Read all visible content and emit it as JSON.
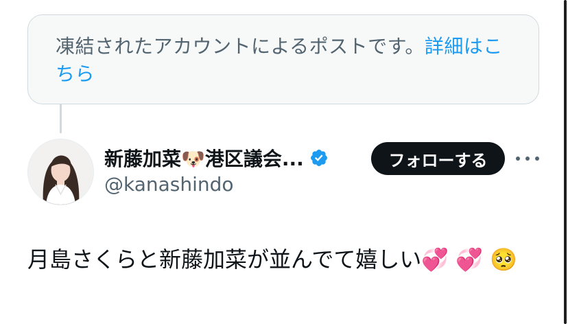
{
  "notice": {
    "text": "凍結されたアカウントによるポストです。",
    "link_label": "詳細はこちら"
  },
  "author": {
    "display_name": "新藤加菜🐶港区議会...",
    "handle": "@kanashindo",
    "verified": true,
    "verified_color": "#1d9bf0"
  },
  "actions": {
    "follow_label": "フォローする",
    "more_icon": "more-horizontal-icon"
  },
  "post": {
    "text": "月島さくらと新藤加菜が並んでて嬉しい💞 💞 🥺"
  },
  "colors": {
    "accent": "#1d9bf0",
    "text_primary": "#0f1419",
    "text_secondary": "#536471",
    "notice_bg": "#f7f9f9",
    "border": "#cfd9de"
  }
}
